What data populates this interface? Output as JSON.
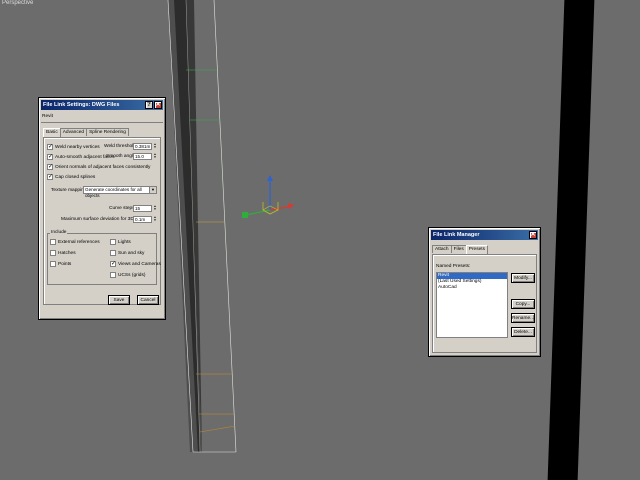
{
  "viewport": {
    "label": "Perspective"
  },
  "settings_dialog": {
    "title": "File Link Settings: DWG Files",
    "help_glyph": "?",
    "close_glyph": "✕",
    "preset_name": "Revit",
    "tabs": [
      {
        "label": "Basic",
        "active": true
      },
      {
        "label": "Advanced",
        "active": false
      },
      {
        "label": "Spline Rendering",
        "active": false
      }
    ],
    "weld_label": "Weld nearby vertices",
    "weld_threshold_label": "Weld threshold",
    "weld_threshold_value": "0.381m",
    "smooth_label": "Auto-smooth adjacent faces",
    "smooth_angle_label": "Smooth angle",
    "smooth_angle_value": "15.0",
    "orient_label": "Orient normals of adjacent faces consistently",
    "cap_label": "Cap closed splines",
    "texture_label": "Texture mapping:",
    "texture_value": "Generate coordinates for all objects",
    "curve_steps_label": "Curve steps:",
    "curve_steps_value": "15",
    "max_dev_label": "Maximum surface deviation for 3D solids:",
    "max_dev_value": "0.1m",
    "include_title": "Include",
    "include_left": [
      {
        "label": "External references",
        "checked": false
      },
      {
        "label": "Hatches",
        "checked": false
      },
      {
        "label": "Points",
        "checked": false
      }
    ],
    "include_right": [
      {
        "label": "Lights",
        "checked": false
      },
      {
        "label": "Sun and sky",
        "checked": false
      },
      {
        "label": "Views and Cameras",
        "checked": true
      },
      {
        "label": "UCSs (grids)",
        "checked": false
      }
    ],
    "save_label": "Save",
    "cancel_label": "Cancel",
    "arrow_up": "▲",
    "arrow_down": "▼",
    "select_arrow": "▼"
  },
  "manager_dialog": {
    "title": "File Link Manager",
    "close_glyph": "✕",
    "tabs": [
      {
        "label": "Attach",
        "active": false
      },
      {
        "label": "Files",
        "active": false
      },
      {
        "label": "Presets",
        "active": true
      }
    ],
    "named_presets_label": "Named Presets:",
    "presets": [
      {
        "label": "Revit",
        "selected": true
      },
      {
        "label": "(Last Used Settings)",
        "selected": false
      },
      {
        "label": "AutoCad",
        "selected": false
      }
    ],
    "modify_label": "Modify...",
    "copy_label": "Copy...",
    "rename_label": "Rename...",
    "delete_label": "Delete..."
  }
}
